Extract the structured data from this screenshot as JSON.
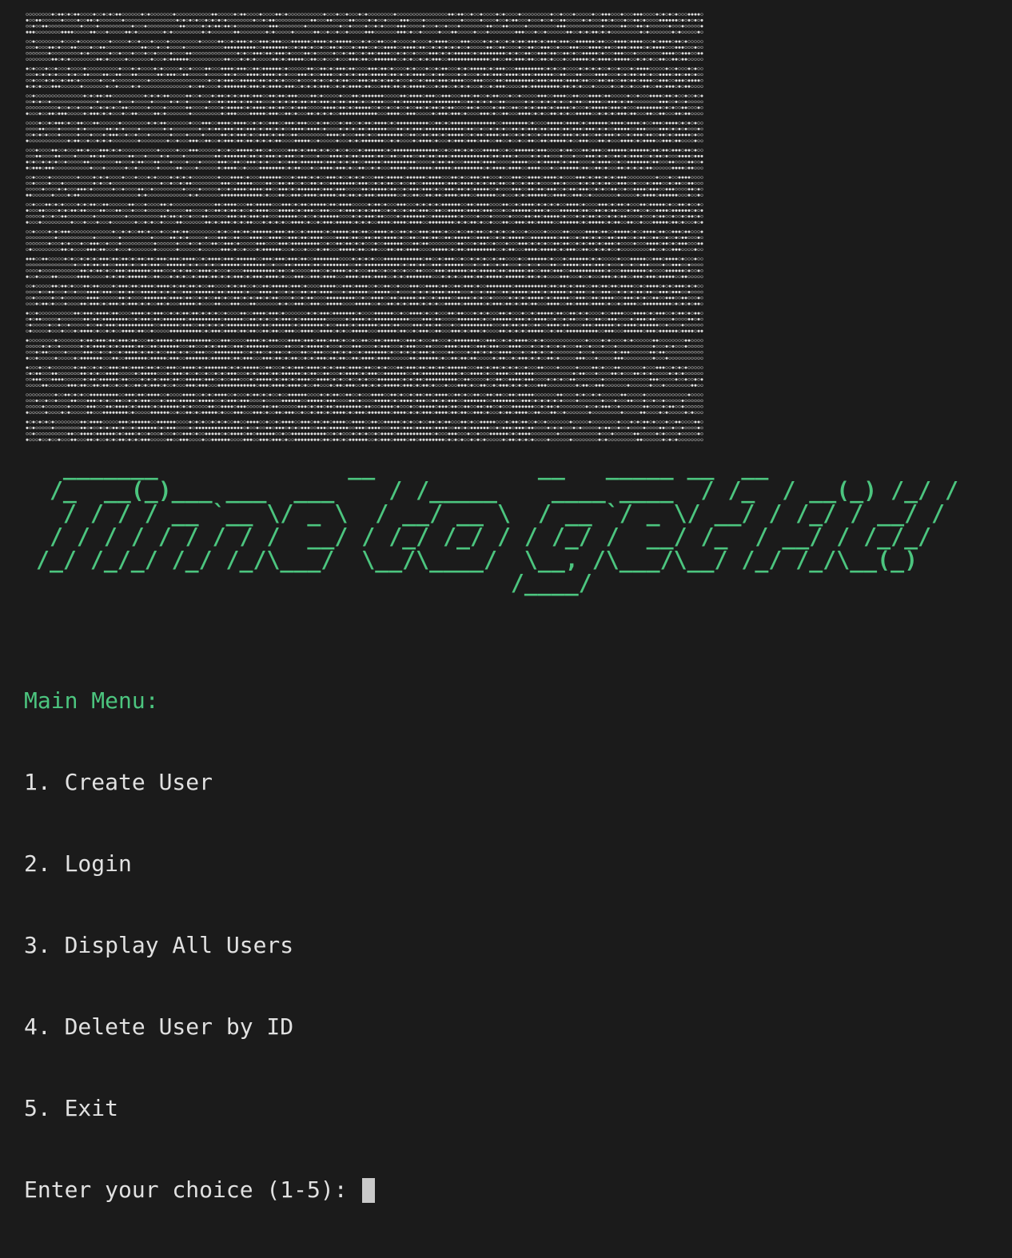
{
  "terminal": {
    "background": "#1b1b1b",
    "text_color": "#e1e1e1",
    "accent_color": "#4cc57f"
  },
  "art": {
    "dot_color": "#dcdcdc"
  },
  "banner": {
    "lines": [
      "   _______              __            __   _____ __  __",
      "  /_  __(_)___ ___  ___    / /_____    ____ ____  / /_  / __(_) /_/ /",
      "   / / / / __ `__ \\/ _ \\  / __/ __ \\  / __ `/ _ \\/ __/ / /_/ / __/ /",
      "  / / / / / / / / /  __/ / /_/ /_/ / / /_/ /  __/ /_  / __/ / /_/_/",
      " /_/ /_/_/ /_/ /_/\\___/  \\__/\\____/  \\__, /\\___/\\__/ /_/ /_/\\__(_)",
      "                                    /____/"
    ]
  },
  "menu": {
    "heading": "Main Menu:",
    "items": [
      "1. Create User",
      "2. Login",
      "3. Display All Users",
      "4. Delete User by ID",
      "5. Exit"
    ],
    "prompt": "Enter your choice (1-5): "
  }
}
